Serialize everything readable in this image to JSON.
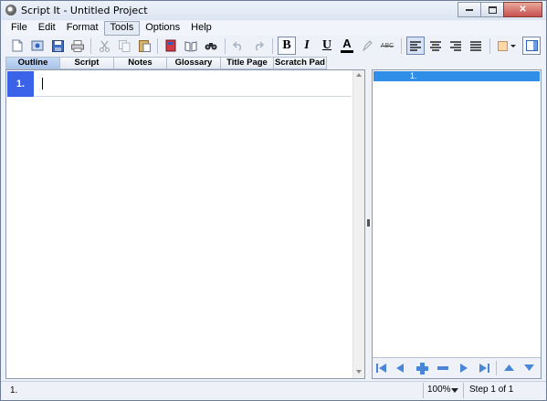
{
  "window": {
    "title": "Script It - Untitled Project"
  },
  "menu": {
    "items": [
      "File",
      "Edit",
      "Format",
      "Tools",
      "Options",
      "Help"
    ],
    "active": "Tools"
  },
  "toolbar": {
    "bold": "B",
    "italic": "I",
    "underline": "U",
    "font_color": "A",
    "strikethrough": "ABC"
  },
  "tabs": [
    "Outline",
    "Script",
    "Notes",
    "Glossary",
    "Title Page",
    "Scratch Pad"
  ],
  "outline": {
    "row_number": "1."
  },
  "steps_panel": {
    "header_item": "1."
  },
  "status": {
    "left": "1.",
    "zoom": "100%",
    "step": "Step 1 of 1"
  }
}
